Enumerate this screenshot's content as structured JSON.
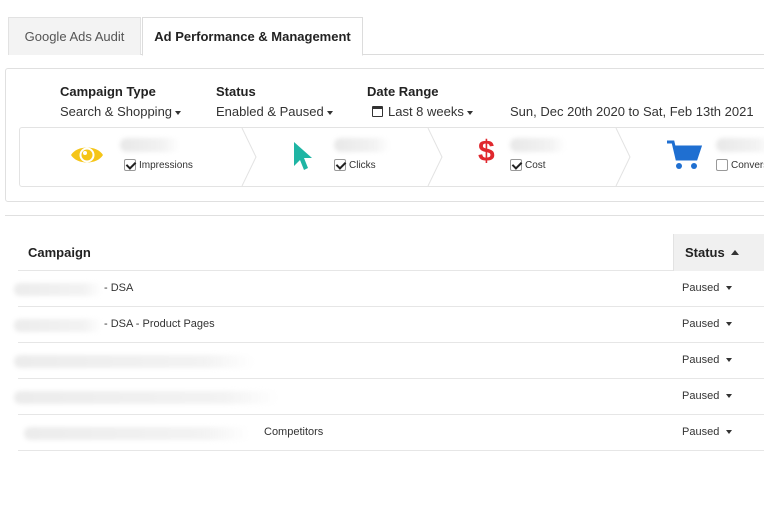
{
  "tabs": [
    {
      "label": "Google Ads Audit",
      "active": false
    },
    {
      "label": "Ad Performance & Management",
      "active": true
    }
  ],
  "filters": {
    "campaign_type": {
      "label": "Campaign Type",
      "value": "Search & Shopping"
    },
    "status": {
      "label": "Status",
      "value": "Enabled & Paused"
    },
    "date_range": {
      "label": "Date Range",
      "value": "Last 8 weeks",
      "range_text": "Sun, Dec 20th 2020 to Sat, Feb 13th 2021"
    }
  },
  "metrics": [
    {
      "label": "Impressions",
      "icon": "eye-icon",
      "checked": true,
      "color": "#f5c518"
    },
    {
      "label": "Clicks",
      "icon": "cursor-icon",
      "checked": true,
      "color": "#1fb5a4"
    },
    {
      "label": "Cost",
      "icon": "dollar-icon",
      "checked": true,
      "color": "#e0282e"
    },
    {
      "label": "Conversi",
      "icon": "cart-icon",
      "checked": false,
      "color": "#1f6fd1"
    }
  ],
  "table": {
    "columns": {
      "campaign": "Campaign",
      "status": "Status"
    },
    "rows": [
      {
        "campaign": "- DSA",
        "status": "Paused"
      },
      {
        "campaign": "- DSA - Product Pages",
        "status": "Paused"
      },
      {
        "campaign": "",
        "status": "Paused"
      },
      {
        "campaign": "",
        "status": "Paused"
      },
      {
        "campaign": "Competitors",
        "status": "Paused"
      }
    ]
  }
}
